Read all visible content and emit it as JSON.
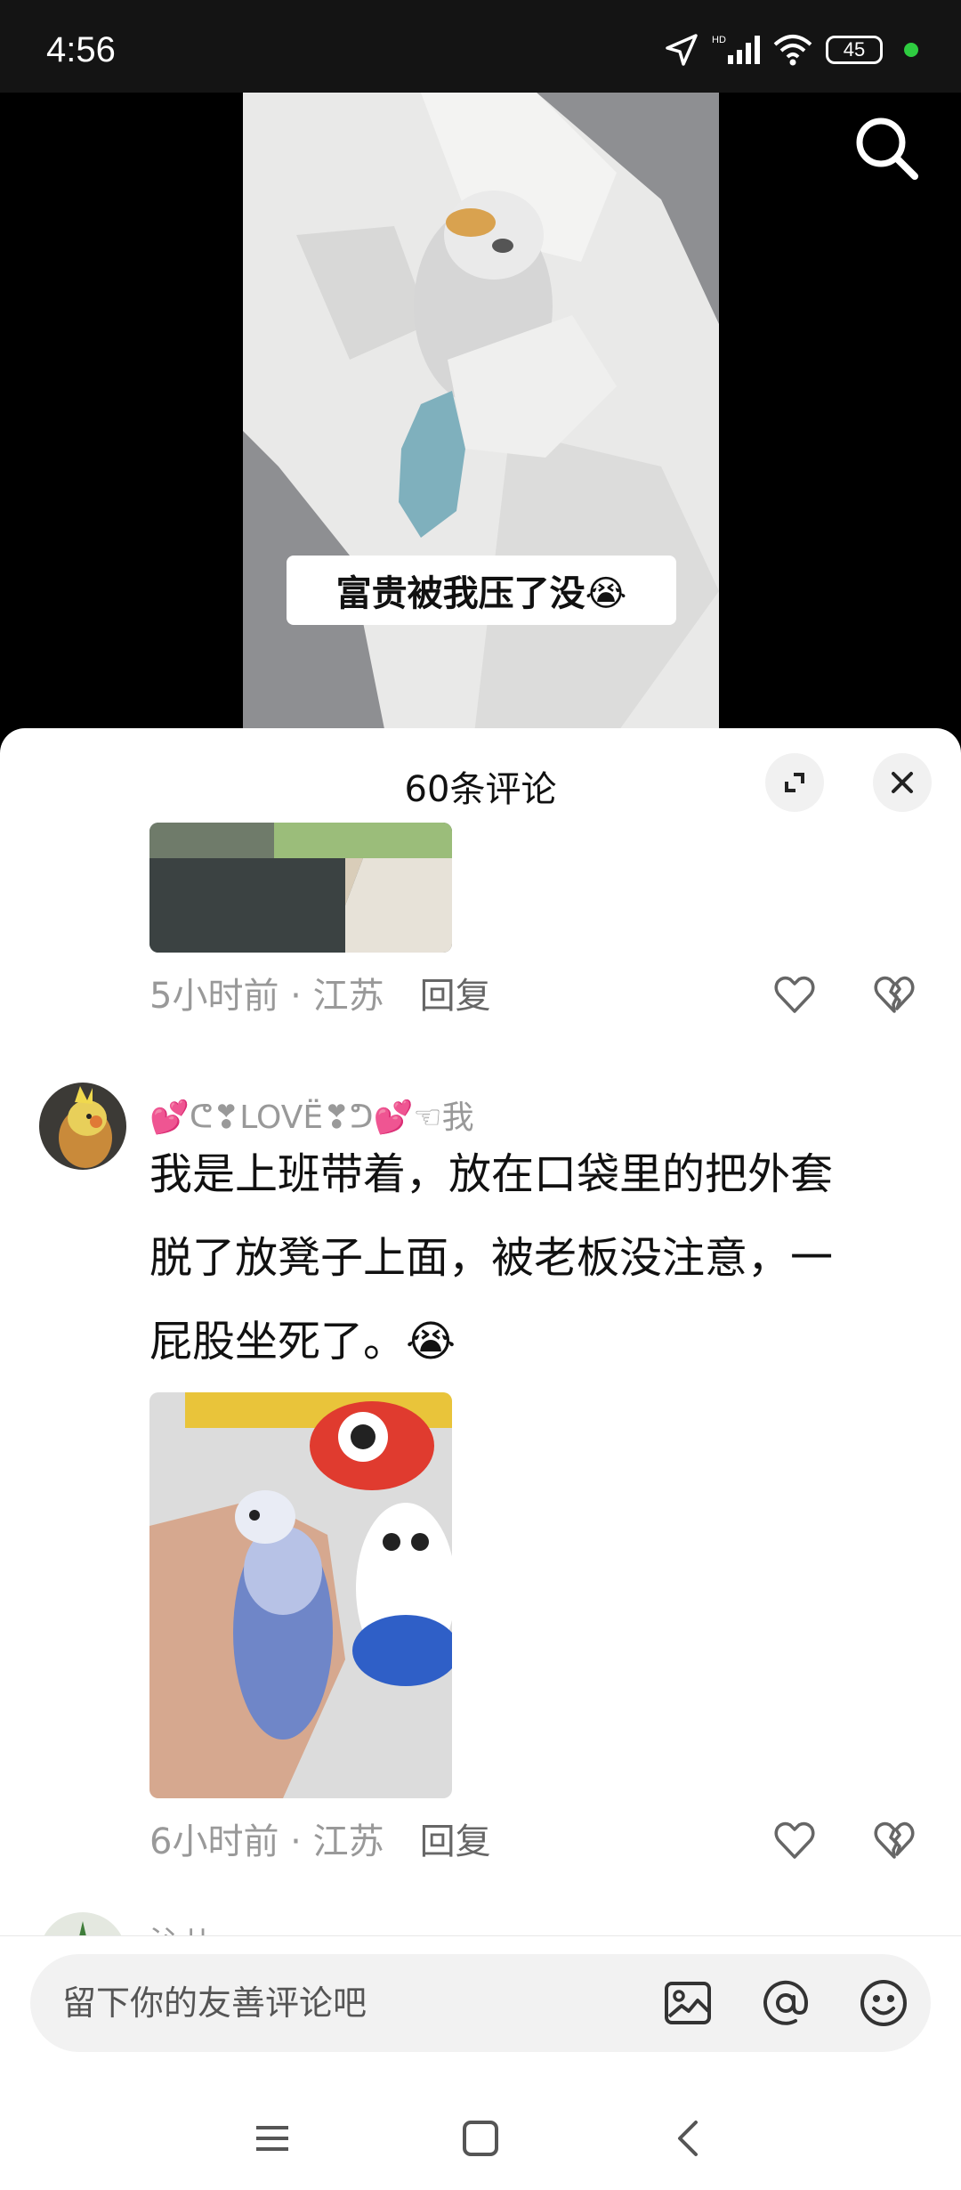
{
  "status_bar": {
    "time": "4:56",
    "battery": "45"
  },
  "video": {
    "caption": "富贵被我压了没😭"
  },
  "comments_panel": {
    "title": "60条评论",
    "comments": [
      {
        "time_location": "5小时前 · 江苏",
        "reply": "回复"
      },
      {
        "username": "💕ᕦ❣LOVË❣ᕤ💕☜我",
        "text_line1": "我是上班带着，放在口袋里的把外套",
        "text_line2": "脱了放凳子上面，被老板没注意，一",
        "text_line3": "屁股坐死了。😭",
        "time_location": "6小时前 · 江苏",
        "reply": "回复"
      },
      {
        "username": "沁儿"
      }
    ]
  },
  "input": {
    "placeholder": "留下你的友善评论吧"
  },
  "colors": {
    "sheet_bg": "#ffffff",
    "meta_text": "#999999",
    "status_dot": "#2ecc40"
  }
}
